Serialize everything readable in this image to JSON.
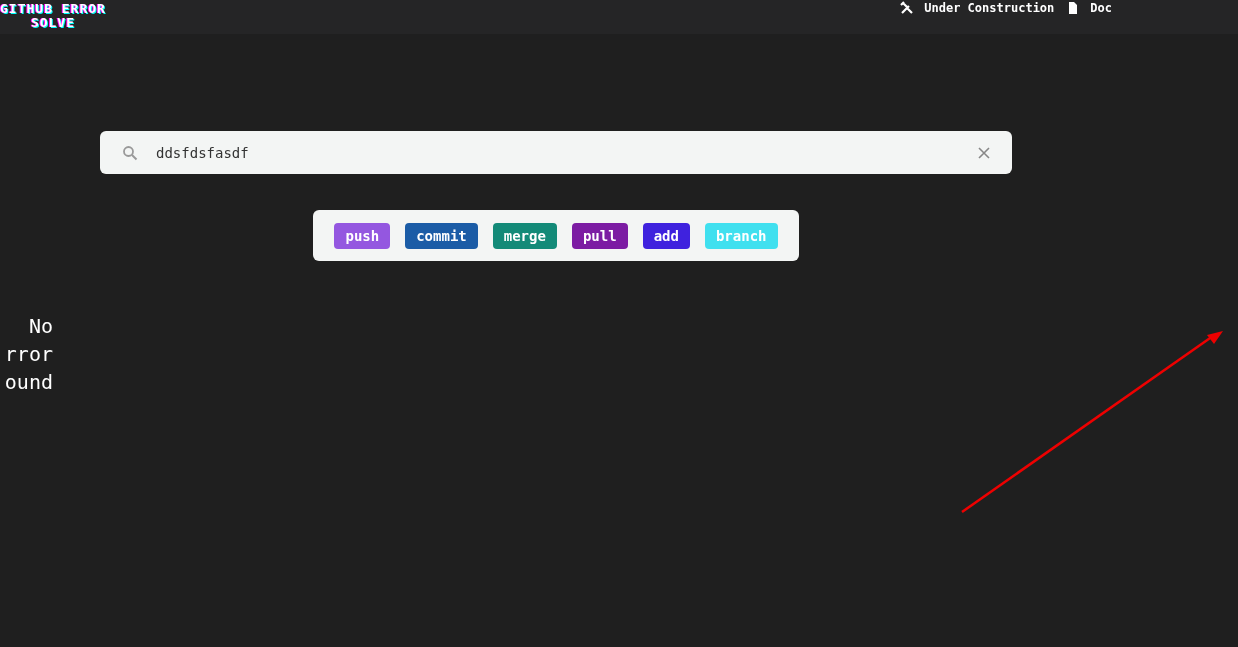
{
  "header": {
    "logo": "GITHUB ERROR\nSOLVE",
    "nav": [
      {
        "kind": "tools",
        "label": "Under Construction"
      },
      {
        "kind": "document",
        "label": "Doc"
      }
    ]
  },
  "search": {
    "value": "ddsfdsfasdf"
  },
  "tags": [
    {
      "label": "push",
      "color": "#9457e0"
    },
    {
      "label": "commit",
      "color": "#1b5ca6"
    },
    {
      "label": "merge",
      "color": "#138a78"
    },
    {
      "label": "pull",
      "color": "#7c1ca3"
    },
    {
      "label": "add",
      "color": "#3f22de"
    },
    {
      "label": "branch",
      "color": "#40e0ef"
    }
  ],
  "message": "No\nrror\nound"
}
